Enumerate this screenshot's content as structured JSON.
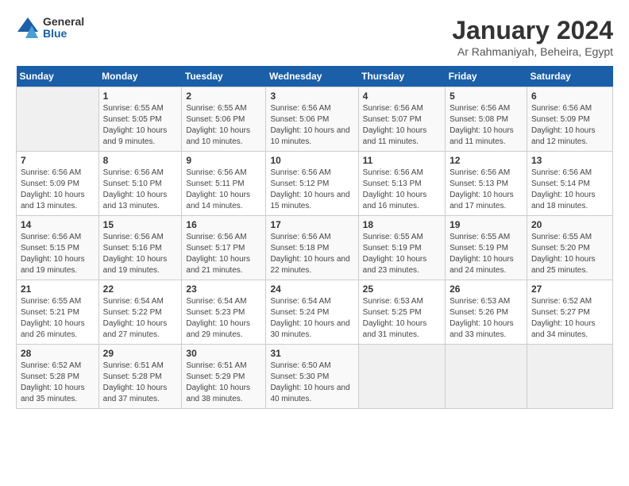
{
  "logo": {
    "general": "General",
    "blue": "Blue"
  },
  "title": "January 2024",
  "subtitle": "Ar Rahmaniyah, Beheira, Egypt",
  "headers": [
    "Sunday",
    "Monday",
    "Tuesday",
    "Wednesday",
    "Thursday",
    "Friday",
    "Saturday"
  ],
  "weeks": [
    [
      {
        "day": "",
        "sunrise": "",
        "sunset": "",
        "daylight": ""
      },
      {
        "day": "1",
        "sunrise": "Sunrise: 6:55 AM",
        "sunset": "Sunset: 5:05 PM",
        "daylight": "Daylight: 10 hours and 9 minutes."
      },
      {
        "day": "2",
        "sunrise": "Sunrise: 6:55 AM",
        "sunset": "Sunset: 5:06 PM",
        "daylight": "Daylight: 10 hours and 10 minutes."
      },
      {
        "day": "3",
        "sunrise": "Sunrise: 6:56 AM",
        "sunset": "Sunset: 5:06 PM",
        "daylight": "Daylight: 10 hours and 10 minutes."
      },
      {
        "day": "4",
        "sunrise": "Sunrise: 6:56 AM",
        "sunset": "Sunset: 5:07 PM",
        "daylight": "Daylight: 10 hours and 11 minutes."
      },
      {
        "day": "5",
        "sunrise": "Sunrise: 6:56 AM",
        "sunset": "Sunset: 5:08 PM",
        "daylight": "Daylight: 10 hours and 11 minutes."
      },
      {
        "day": "6",
        "sunrise": "Sunrise: 6:56 AM",
        "sunset": "Sunset: 5:09 PM",
        "daylight": "Daylight: 10 hours and 12 minutes."
      }
    ],
    [
      {
        "day": "7",
        "sunrise": "Sunrise: 6:56 AM",
        "sunset": "Sunset: 5:09 PM",
        "daylight": "Daylight: 10 hours and 13 minutes."
      },
      {
        "day": "8",
        "sunrise": "Sunrise: 6:56 AM",
        "sunset": "Sunset: 5:10 PM",
        "daylight": "Daylight: 10 hours and 13 minutes."
      },
      {
        "day": "9",
        "sunrise": "Sunrise: 6:56 AM",
        "sunset": "Sunset: 5:11 PM",
        "daylight": "Daylight: 10 hours and 14 minutes."
      },
      {
        "day": "10",
        "sunrise": "Sunrise: 6:56 AM",
        "sunset": "Sunset: 5:12 PM",
        "daylight": "Daylight: 10 hours and 15 minutes."
      },
      {
        "day": "11",
        "sunrise": "Sunrise: 6:56 AM",
        "sunset": "Sunset: 5:13 PM",
        "daylight": "Daylight: 10 hours and 16 minutes."
      },
      {
        "day": "12",
        "sunrise": "Sunrise: 6:56 AM",
        "sunset": "Sunset: 5:13 PM",
        "daylight": "Daylight: 10 hours and 17 minutes."
      },
      {
        "day": "13",
        "sunrise": "Sunrise: 6:56 AM",
        "sunset": "Sunset: 5:14 PM",
        "daylight": "Daylight: 10 hours and 18 minutes."
      }
    ],
    [
      {
        "day": "14",
        "sunrise": "Sunrise: 6:56 AM",
        "sunset": "Sunset: 5:15 PM",
        "daylight": "Daylight: 10 hours and 19 minutes."
      },
      {
        "day": "15",
        "sunrise": "Sunrise: 6:56 AM",
        "sunset": "Sunset: 5:16 PM",
        "daylight": "Daylight: 10 hours and 19 minutes."
      },
      {
        "day": "16",
        "sunrise": "Sunrise: 6:56 AM",
        "sunset": "Sunset: 5:17 PM",
        "daylight": "Daylight: 10 hours and 21 minutes."
      },
      {
        "day": "17",
        "sunrise": "Sunrise: 6:56 AM",
        "sunset": "Sunset: 5:18 PM",
        "daylight": "Daylight: 10 hours and 22 minutes."
      },
      {
        "day": "18",
        "sunrise": "Sunrise: 6:55 AM",
        "sunset": "Sunset: 5:19 PM",
        "daylight": "Daylight: 10 hours and 23 minutes."
      },
      {
        "day": "19",
        "sunrise": "Sunrise: 6:55 AM",
        "sunset": "Sunset: 5:19 PM",
        "daylight": "Daylight: 10 hours and 24 minutes."
      },
      {
        "day": "20",
        "sunrise": "Sunrise: 6:55 AM",
        "sunset": "Sunset: 5:20 PM",
        "daylight": "Daylight: 10 hours and 25 minutes."
      }
    ],
    [
      {
        "day": "21",
        "sunrise": "Sunrise: 6:55 AM",
        "sunset": "Sunset: 5:21 PM",
        "daylight": "Daylight: 10 hours and 26 minutes."
      },
      {
        "day": "22",
        "sunrise": "Sunrise: 6:54 AM",
        "sunset": "Sunset: 5:22 PM",
        "daylight": "Daylight: 10 hours and 27 minutes."
      },
      {
        "day": "23",
        "sunrise": "Sunrise: 6:54 AM",
        "sunset": "Sunset: 5:23 PM",
        "daylight": "Daylight: 10 hours and 29 minutes."
      },
      {
        "day": "24",
        "sunrise": "Sunrise: 6:54 AM",
        "sunset": "Sunset: 5:24 PM",
        "daylight": "Daylight: 10 hours and 30 minutes."
      },
      {
        "day": "25",
        "sunrise": "Sunrise: 6:53 AM",
        "sunset": "Sunset: 5:25 PM",
        "daylight": "Daylight: 10 hours and 31 minutes."
      },
      {
        "day": "26",
        "sunrise": "Sunrise: 6:53 AM",
        "sunset": "Sunset: 5:26 PM",
        "daylight": "Daylight: 10 hours and 33 minutes."
      },
      {
        "day": "27",
        "sunrise": "Sunrise: 6:52 AM",
        "sunset": "Sunset: 5:27 PM",
        "daylight": "Daylight: 10 hours and 34 minutes."
      }
    ],
    [
      {
        "day": "28",
        "sunrise": "Sunrise: 6:52 AM",
        "sunset": "Sunset: 5:28 PM",
        "daylight": "Daylight: 10 hours and 35 minutes."
      },
      {
        "day": "29",
        "sunrise": "Sunrise: 6:51 AM",
        "sunset": "Sunset: 5:28 PM",
        "daylight": "Daylight: 10 hours and 37 minutes."
      },
      {
        "day": "30",
        "sunrise": "Sunrise: 6:51 AM",
        "sunset": "Sunset: 5:29 PM",
        "daylight": "Daylight: 10 hours and 38 minutes."
      },
      {
        "day": "31",
        "sunrise": "Sunrise: 6:50 AM",
        "sunset": "Sunset: 5:30 PM",
        "daylight": "Daylight: 10 hours and 40 minutes."
      },
      {
        "day": "",
        "sunrise": "",
        "sunset": "",
        "daylight": ""
      },
      {
        "day": "",
        "sunrise": "",
        "sunset": "",
        "daylight": ""
      },
      {
        "day": "",
        "sunrise": "",
        "sunset": "",
        "daylight": ""
      }
    ]
  ]
}
